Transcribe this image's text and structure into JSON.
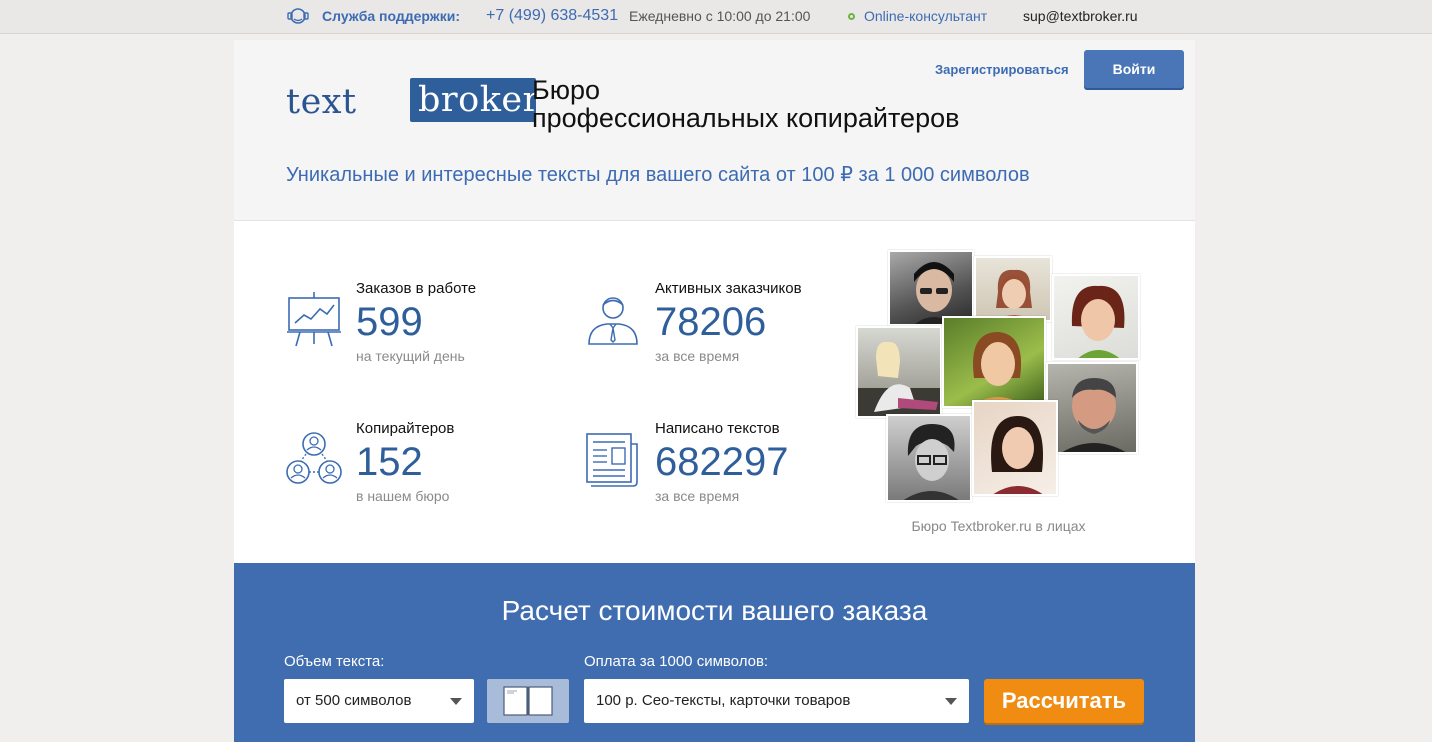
{
  "topbar": {
    "support_label": "Служба поддержки:",
    "phone": "+7 (499) 638-4531",
    "hours": "Ежедневно с 10:00 до 21:00",
    "consultant": "Online-консультант",
    "email": "sup@textbroker.ru"
  },
  "header": {
    "logo_text": "text",
    "logo_box_text": "broker",
    "bureau_line1": "Бюро",
    "bureau_line2": "профессиональных копирайтеров",
    "register_link": "Зарегистрироваться",
    "login_button": "Войти",
    "tagline": "Уникальные и интересные тексты для вашего сайта от 100 ₽ за 1 000 символов"
  },
  "stats": [
    {
      "label": "Заказов в работе",
      "value": "599",
      "sub": "на текущий день",
      "icon": "presentation-chart-icon"
    },
    {
      "label": "Активных заказчиков",
      "value": "78206",
      "sub": "за все время",
      "icon": "customer-icon"
    },
    {
      "label": "Копирайтеров",
      "value": "152",
      "sub": "в нашем бюро",
      "icon": "team-network-icon"
    },
    {
      "label": "Написано текстов",
      "value": "682297",
      "sub": "за все время",
      "icon": "newspaper-icon"
    }
  ],
  "collage": {
    "caption": "Бюро Textbroker.ru в лицах"
  },
  "calculator": {
    "title": "Расчет стоимости вашего заказа",
    "volume_label": "Объем текста:",
    "volume_value": "от 500 символов",
    "price_label": "Оплата за 1000 символов:",
    "price_value": "100 р. Сео-тексты, карточки товаров",
    "calc_button": "Рассчитать"
  },
  "colors": {
    "brand_blue": "#3d6bb3",
    "calc_bg": "#3f6db0",
    "accent_orange": "#f08c12"
  }
}
